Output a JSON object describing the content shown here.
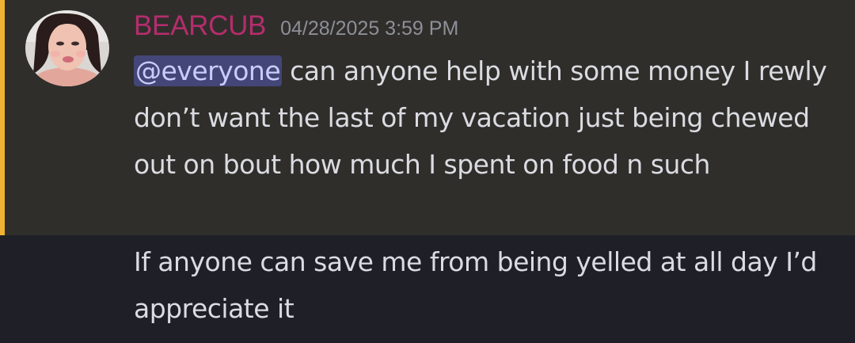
{
  "message": {
    "author": "BEARCUB",
    "timestamp": "04/28/2025 3:59 PM",
    "mention": "@everyone",
    "text_after_mention": " can anyone help with some money I rewly don’t want the last of my vacation just being chewed out on bout how much I spent on food n such"
  },
  "followup": {
    "text": "If anyone can save me from being yelled at all day I’d appreciate it"
  },
  "colors": {
    "username": "#b42d6c",
    "mention_bar": "#f0b232",
    "mention_bg": "#434676",
    "highlight_bg": "#2f2e2b"
  },
  "avatar": {
    "icon": "user-avatar-photo"
  }
}
